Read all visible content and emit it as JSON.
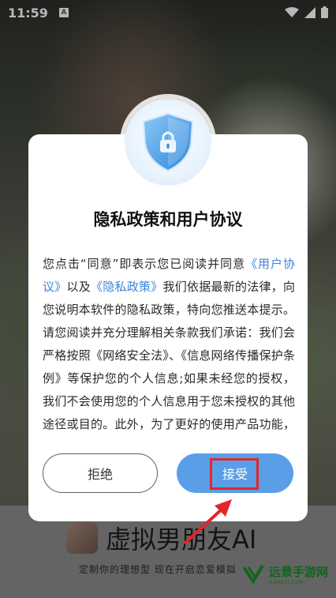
{
  "status_bar": {
    "time": "11:59",
    "notification_icon": "A"
  },
  "dialog": {
    "title": "隐私政策和用户协议",
    "body": {
      "p1": "您点击“同意”即表示您已阅读并同意",
      "link_user": "《用户协议》",
      "p2": "以及",
      "link_privacy": "《隐私政策》",
      "p3": "我们依据最新的法律，向您说明本软件的隐私政策，特向您推送本提示。请您阅读并充分理解相关条款我们承诺：我们会严格按照《网络安全法》、《信息网络传播保护条例》等保护您的个人信息;如果未经您的授权，我们不会使用您的个人信息用于您未授权的其他途径或目的。此外，为了更好的使用产品功能，现征求您"
    },
    "reject_label": "拒绝",
    "accept_label": "接受"
  },
  "app": {
    "name": "虚拟男朋友AI",
    "slogan": "定制你的理想型 现在开启恋爱模拟"
  },
  "watermark": {
    "main": "远景手游网",
    "sub": "GAMEYJ.COM"
  },
  "colors": {
    "accent": "#5b9ee8",
    "link": "#3d84d8",
    "highlight": "#e3262a"
  }
}
